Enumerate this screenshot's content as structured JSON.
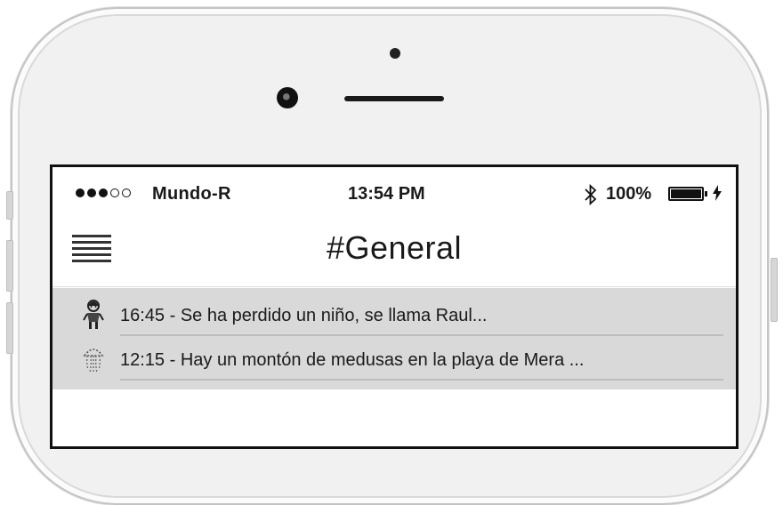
{
  "status_bar": {
    "carrier": "Mundo-R",
    "time": "13:54 PM",
    "battery_percent": "100%",
    "battery_level": 1.0,
    "signal_bars": 3,
    "signal_max": 5,
    "bluetooth_icon": "bluetooth-icon",
    "charging_icon": "lightning-bolt-icon"
  },
  "header": {
    "title": "#General",
    "menu_icon": "hamburger-menu-icon"
  },
  "feed": {
    "items": [
      {
        "text": "16:45 - Se ha perdido un niño, se llama Raul...",
        "icon": "lost-child-icon"
      },
      {
        "text": "12:15 - Hay un montón de medusas en la playa de Mera ...",
        "icon": "jellyfish-icon"
      }
    ]
  },
  "colors": {
    "feed_background": "#d9d9d9",
    "screen_background": "#ffffff",
    "phone_body": "#f1f1f1"
  }
}
